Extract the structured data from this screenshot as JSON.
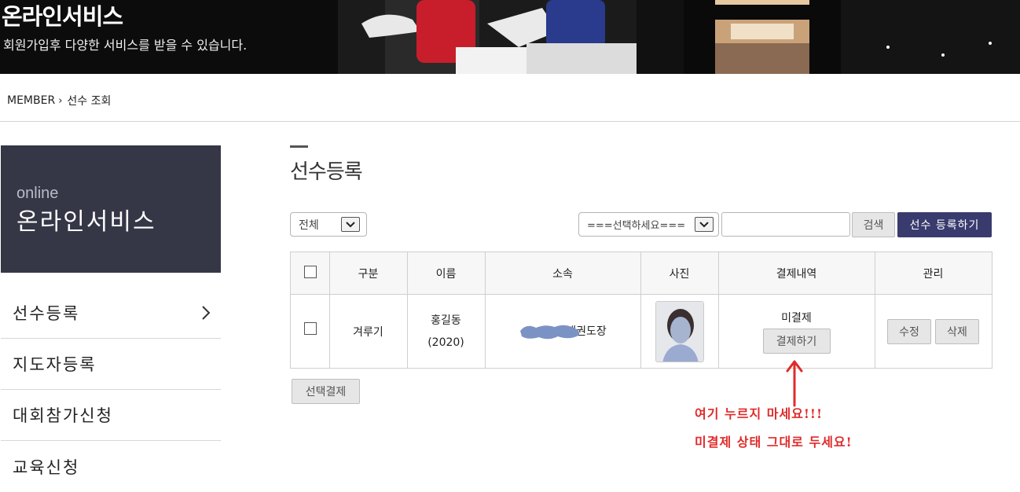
{
  "banner": {
    "title": "온라인서비스",
    "subtitle": "회원가입후 다양한 서비스를 받을 수 있습니다."
  },
  "breadcrumb": {
    "root": "MEMBER",
    "separator": "›",
    "current": "선수 조회"
  },
  "sidebar": {
    "label_en": "online",
    "title": "온라인서비스",
    "items": [
      {
        "label": "선수등록"
      },
      {
        "label": "지도자등록"
      },
      {
        "label": "대회참가신청"
      },
      {
        "label": "교육신청"
      }
    ]
  },
  "main": {
    "heading": "선수등록",
    "filter_select": "전체",
    "search_select": "===선택하세요===",
    "search_input_value": "",
    "search_button": "검색",
    "register_button": "선수 등록하기",
    "table": {
      "headers": [
        "구분",
        "이름",
        "소속",
        "사진",
        "결제내역",
        "관리"
      ],
      "rows": [
        {
          "category": "겨루기",
          "name": "홍길동",
          "year": "(2020)",
          "affiliation": "태권도장",
          "payment_status": "미결제",
          "pay_button": "결제하기",
          "edit_button": "수정",
          "delete_button": "삭제"
        }
      ]
    },
    "bulk_pay_button": "선택결제"
  },
  "annotation": {
    "line1": "여기 누르지 마세요!!!",
    "line2": "미결제 상태 그대로 두세요!",
    "color": "#e02b2b"
  },
  "colors": {
    "sidebar_box": "#353746",
    "navy_button": "#393b6e"
  }
}
